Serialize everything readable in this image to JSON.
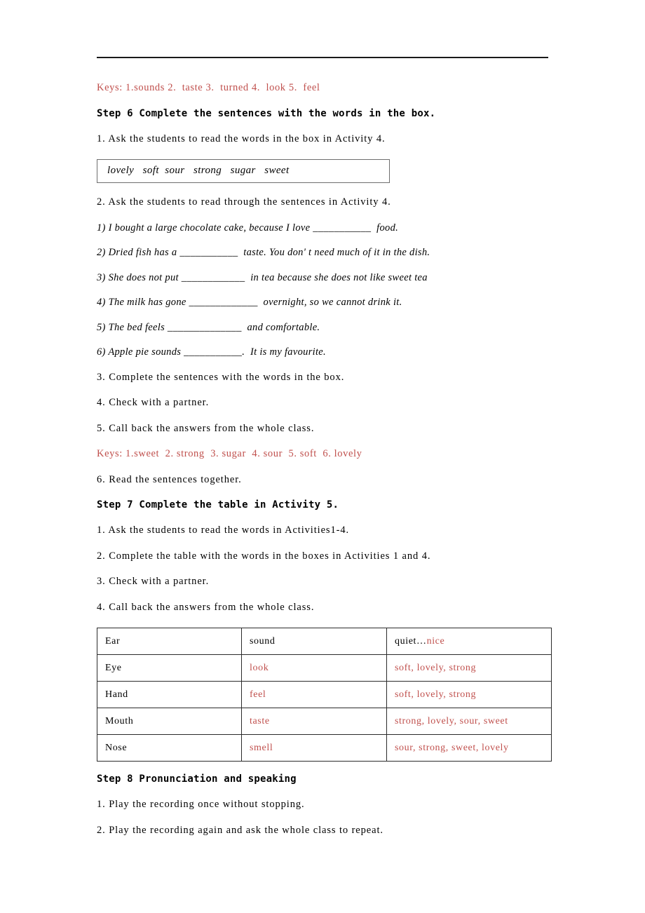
{
  "document": {
    "keys_line_1": "Keys: 1.sounds 2.  taste 3.  turned 4.  look 5.  feel",
    "step6_heading": "Step 6 Complete the sentences with the words in the box.",
    "step6_item_1": "1. Ask the students to read the words in the box in Activity 4.",
    "word_box": "lovely   soft  sour   strong   sugar   sweet",
    "step6_item_2": "2. Ask the students to read through the sentences in Activity 4.",
    "exercise_sentences": [
      "1) I bought a large chocolate cake, because I love ___________  food.",
      "2) Dried fish has a ___________  taste. You don' t need much of it in the dish.",
      "3) She does not put ____________  in tea because she does not like sweet tea",
      "4) The milk has gone _____________  overnight, so we cannot drink it.",
      "5) The bed feels ______________  and comfortable.",
      "6) Apple pie sounds ___________.  It is my favourite."
    ],
    "step6_item_3": "3. Complete the sentences with the words in the box.",
    "step6_item_4": "4. Check with a partner.",
    "step6_item_5": "5. Call back the answers from the whole class.",
    "keys_line_2": "Keys: 1.sweet  2. strong  3. sugar  4. sour  5. soft  6. lovely",
    "step6_item_6": "6. Read the sentences together.",
    "step7_heading": "Step 7 Complete the table in Activity 5.",
    "step7_item_1": "1. Ask the students to read the words in Activities1-4.",
    "step7_item_2": "2. Complete the table with the words in the boxes in Activities 1 and 4.",
    "step7_item_3": "3. Check with a partner.",
    "step7_item_4": "4. Call back the answers from the whole class.",
    "step8_heading": "Step 8 Pronunciation and speaking",
    "step8_item_1": "1. Play the recording once without stopping.",
    "step8_item_2": "2. Play the recording again and ask the whole class to repeat."
  },
  "sense_table": {
    "rows": [
      {
        "organ": "Ear",
        "verb": "sound",
        "verb_color": "black",
        "adjectives_prefix": "quiet…",
        "adjectives": "nice",
        "adjectives_split": true
      },
      {
        "organ": "Eye",
        "verb": "look",
        "verb_color": "red",
        "adjectives": "soft, lovely, strong",
        "adjectives_split": false
      },
      {
        "organ": "Hand",
        "verb": "feel",
        "verb_color": "red",
        "adjectives": "soft, lovely, strong",
        "adjectives_split": false
      },
      {
        "organ": "Mouth",
        "verb": "taste",
        "verb_color": "red",
        "adjectives": "strong, lovely, sour, sweet",
        "adjectives_split": false
      },
      {
        "organ": "Nose",
        "verb": "smell",
        "verb_color": "red",
        "adjectives": "sour, strong, sweet, lovely",
        "adjectives_split": false
      }
    ]
  },
  "colors": {
    "answer_red": "#c0504d",
    "text_black": "#000000",
    "rule": "#1a1a1a"
  }
}
